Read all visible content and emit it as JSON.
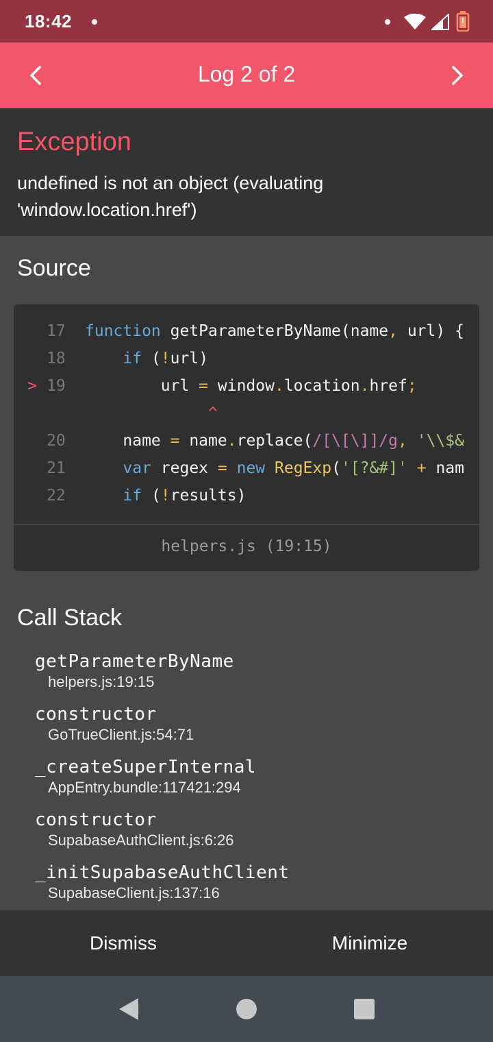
{
  "status_bar": {
    "time": "18:42"
  },
  "header": {
    "title": "Log 2 of 2",
    "prev_icon": "chevron-left-icon",
    "next_icon": "chevron-right-icon"
  },
  "exception": {
    "heading": "Exception",
    "message": "undefined is not an object (evaluating 'window.location.href')"
  },
  "source": {
    "heading": "Source",
    "lines": [
      {
        "num": "17",
        "text": "function getParameterByName(name, url) {"
      },
      {
        "num": "18",
        "text": "    if (!url)"
      },
      {
        "num": "19",
        "text": "        url = window.location.href;",
        "marker": ">"
      },
      {
        "num": "",
        "text": "             ^"
      },
      {
        "num": "20",
        "text": "    name = name.replace(/[\\[\\]]/g, '\\\\$&"
      },
      {
        "num": "21",
        "text": "    var regex = new RegExp('[?&#]' + nam"
      },
      {
        "num": "22",
        "text": "    if (!results)"
      }
    ],
    "file": "helpers.js (19:15)"
  },
  "call_stack": {
    "heading": "Call Stack",
    "frames": [
      {
        "fn": "getParameterByName",
        "loc": "helpers.js:19:15"
      },
      {
        "fn": "constructor",
        "loc": "GoTrueClient.js:54:71"
      },
      {
        "fn": "_createSuperInternal",
        "loc": "AppEntry.bundle:117421:294"
      },
      {
        "fn": "constructor",
        "loc": "SupabaseAuthClient.js:6:26"
      },
      {
        "fn": "_initSupabaseAuthClient",
        "loc": "SupabaseClient.js:137:16"
      }
    ]
  },
  "footer": {
    "dismiss": "Dismiss",
    "minimize": "Minimize"
  },
  "colors": {
    "accent": "#f2566b",
    "status_bar": "#943440",
    "panel": "#333333",
    "background": "#484848"
  }
}
